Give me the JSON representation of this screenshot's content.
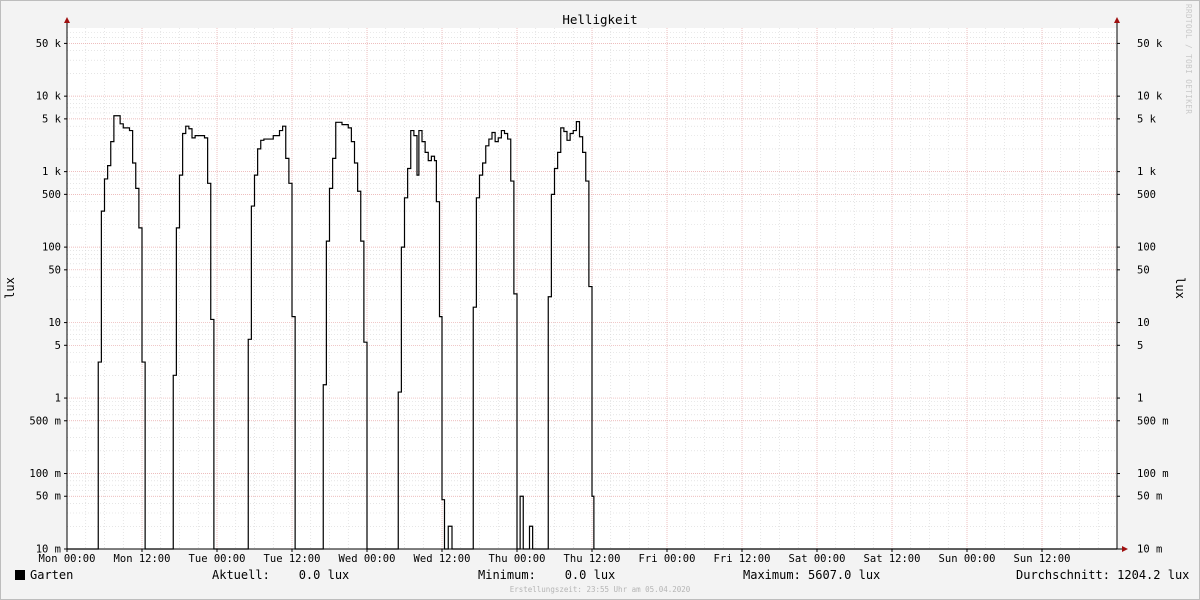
{
  "chart_data": {
    "type": "line",
    "title": "Helligkeit",
    "ylabel": "lux",
    "y_scale": "log",
    "ylim": [
      0.01,
      80000
    ],
    "y_ticks": [
      {
        "v": 0.01,
        "label": "10 m"
      },
      {
        "v": 0.05,
        "label": "50 m"
      },
      {
        "v": 0.1,
        "label": "100 m"
      },
      {
        "v": 0.5,
        "label": "500 m"
      },
      {
        "v": 1,
        "label": "1"
      },
      {
        "v": 5,
        "label": "5"
      },
      {
        "v": 10,
        "label": "10"
      },
      {
        "v": 50,
        "label": "50"
      },
      {
        "v": 100,
        "label": "100"
      },
      {
        "v": 500,
        "label": "500"
      },
      {
        "v": 1000,
        "label": "1 k"
      },
      {
        "v": 5000,
        "label": "5 k"
      },
      {
        "v": 10000,
        "label": "10 k"
      },
      {
        "v": 50000,
        "label": "50 k"
      }
    ],
    "x_unit": "hours since Mon 00:00",
    "xlim": [
      0,
      168
    ],
    "x_ticks": [
      {
        "v": 0,
        "label": "Mon 00:00"
      },
      {
        "v": 12,
        "label": "Mon 12:00"
      },
      {
        "v": 24,
        "label": "Tue 00:00"
      },
      {
        "v": 36,
        "label": "Tue 12:00"
      },
      {
        "v": 48,
        "label": "Wed 00:00"
      },
      {
        "v": 60,
        "label": "Wed 12:00"
      },
      {
        "v": 72,
        "label": "Thu 00:00"
      },
      {
        "v": 84,
        "label": "Thu 12:00"
      },
      {
        "v": 96,
        "label": "Fri 00:00"
      },
      {
        "v": 108,
        "label": "Fri 12:00"
      },
      {
        "v": 120,
        "label": "Sat 00:00"
      },
      {
        "v": 132,
        "label": "Sat 12:00"
      },
      {
        "v": 144,
        "label": "Sun 00:00"
      },
      {
        "v": 156,
        "label": "Sun 12:00"
      }
    ],
    "grid": true,
    "series": [
      {
        "name": "Garten",
        "color": "#000000",
        "points": [
          [
            0,
            0.01
          ],
          [
            5.0,
            0.01
          ],
          [
            5.0,
            3
          ],
          [
            5.5,
            3
          ],
          [
            5.5,
            300
          ],
          [
            6.0,
            300
          ],
          [
            6.0,
            800
          ],
          [
            6.5,
            800
          ],
          [
            6.5,
            1200
          ],
          [
            7.0,
            1200
          ],
          [
            7.0,
            2500
          ],
          [
            7.5,
            2500
          ],
          [
            7.5,
            5500
          ],
          [
            8.5,
            5500
          ],
          [
            8.5,
            4300
          ],
          [
            9.0,
            4300
          ],
          [
            9.0,
            3800
          ],
          [
            10.0,
            3800
          ],
          [
            10.0,
            3500
          ],
          [
            10.5,
            3500
          ],
          [
            10.5,
            1300
          ],
          [
            11.0,
            1300
          ],
          [
            11.0,
            600
          ],
          [
            11.5,
            600
          ],
          [
            11.5,
            180
          ],
          [
            12.0,
            180
          ],
          [
            12.0,
            3
          ],
          [
            12.5,
            3
          ],
          [
            12.5,
            0.01
          ],
          [
            17.0,
            0.01
          ],
          [
            17.0,
            2
          ],
          [
            17.5,
            2
          ],
          [
            17.5,
            180
          ],
          [
            18.0,
            180
          ],
          [
            18.0,
            900
          ],
          [
            18.5,
            900
          ],
          [
            18.5,
            3200
          ],
          [
            19.0,
            3200
          ],
          [
            19.0,
            4000
          ],
          [
            19.5,
            4000
          ],
          [
            19.5,
            3700
          ],
          [
            20.0,
            3700
          ],
          [
            20.0,
            2800
          ],
          [
            20.5,
            2800
          ],
          [
            20.5,
            3000
          ],
          [
            22.0,
            3000
          ],
          [
            22.0,
            2800
          ],
          [
            22.5,
            2800
          ],
          [
            22.5,
            700
          ],
          [
            23.0,
            700
          ],
          [
            23.0,
            11
          ],
          [
            23.5,
            11
          ],
          [
            23.5,
            0.01
          ],
          [
            29.0,
            0.01
          ],
          [
            29.0,
            6
          ],
          [
            29.5,
            6
          ],
          [
            29.5,
            350
          ],
          [
            30.0,
            350
          ],
          [
            30.0,
            900
          ],
          [
            30.5,
            900
          ],
          [
            30.5,
            2000
          ],
          [
            31.0,
            2000
          ],
          [
            31.0,
            2600
          ],
          [
            31.5,
            2600
          ],
          [
            31.5,
            2700
          ],
          [
            33.0,
            2700
          ],
          [
            33.0,
            3000
          ],
          [
            34.0,
            3000
          ],
          [
            34.0,
            3500
          ],
          [
            34.5,
            3500
          ],
          [
            34.5,
            4000
          ],
          [
            35.0,
            4000
          ],
          [
            35.0,
            1500
          ],
          [
            35.5,
            1500
          ],
          [
            35.5,
            700
          ],
          [
            36.0,
            700
          ],
          [
            36.0,
            12
          ],
          [
            36.5,
            12
          ],
          [
            36.5,
            0.01
          ],
          [
            41.0,
            0.01
          ],
          [
            41.0,
            1.5
          ],
          [
            41.5,
            1.5
          ],
          [
            41.5,
            120
          ],
          [
            42.0,
            120
          ],
          [
            42.0,
            600
          ],
          [
            42.5,
            600
          ],
          [
            42.5,
            1500
          ],
          [
            43.0,
            1500
          ],
          [
            43.0,
            4500
          ],
          [
            44.0,
            4500
          ],
          [
            44.0,
            4200
          ],
          [
            45.0,
            4200
          ],
          [
            45.0,
            3800
          ],
          [
            45.5,
            3800
          ],
          [
            45.5,
            2500
          ],
          [
            46.0,
            2500
          ],
          [
            46.0,
            1300
          ],
          [
            46.5,
            1300
          ],
          [
            46.5,
            550
          ],
          [
            47.0,
            550
          ],
          [
            47.0,
            120
          ],
          [
            47.5,
            120
          ],
          [
            47.5,
            5.5
          ],
          [
            48.0,
            5.5
          ],
          [
            48.0,
            0.01
          ],
          [
            53.0,
            0.01
          ],
          [
            53.0,
            1.2
          ],
          [
            53.5,
            1.2
          ],
          [
            53.5,
            100
          ],
          [
            54.0,
            100
          ],
          [
            54.0,
            450
          ],
          [
            54.5,
            450
          ],
          [
            54.5,
            1100
          ],
          [
            55.0,
            1100
          ],
          [
            55.0,
            3500
          ],
          [
            55.5,
            3500
          ],
          [
            55.5,
            3000
          ],
          [
            56.0,
            3000
          ],
          [
            56.0,
            900
          ],
          [
            56.3,
            900
          ],
          [
            56.3,
            3500
          ],
          [
            56.8,
            3500
          ],
          [
            56.8,
            2500
          ],
          [
            57.3,
            2500
          ],
          [
            57.3,
            1800
          ],
          [
            57.8,
            1800
          ],
          [
            57.8,
            1400
          ],
          [
            58.3,
            1400
          ],
          [
            58.3,
            1600
          ],
          [
            58.8,
            1600
          ],
          [
            58.8,
            1400
          ],
          [
            59.1,
            1400
          ],
          [
            59.1,
            400
          ],
          [
            59.6,
            400
          ],
          [
            59.6,
            12
          ],
          [
            60.0,
            12
          ],
          [
            60.0,
            0.045
          ],
          [
            60.4,
            0.045
          ],
          [
            60.4,
            0.01
          ],
          [
            61.0,
            0.01
          ],
          [
            61.0,
            0.02
          ],
          [
            61.6,
            0.02
          ],
          [
            61.6,
            0.01
          ],
          [
            65.0,
            0.01
          ],
          [
            65.0,
            16
          ],
          [
            65.5,
            16
          ],
          [
            65.5,
            450
          ],
          [
            66.0,
            450
          ],
          [
            66.0,
            900
          ],
          [
            66.5,
            900
          ],
          [
            66.5,
            1300
          ],
          [
            67.0,
            1300
          ],
          [
            67.0,
            2200
          ],
          [
            67.5,
            2200
          ],
          [
            67.5,
            2700
          ],
          [
            68.0,
            2700
          ],
          [
            68.0,
            3300
          ],
          [
            68.5,
            3300
          ],
          [
            68.5,
            2500
          ],
          [
            69.0,
            2500
          ],
          [
            69.0,
            2800
          ],
          [
            69.5,
            2800
          ],
          [
            69.5,
            3500
          ],
          [
            70.0,
            3500
          ],
          [
            70.0,
            3200
          ],
          [
            70.5,
            3200
          ],
          [
            70.5,
            2700
          ],
          [
            71.0,
            2700
          ],
          [
            71.0,
            750
          ],
          [
            71.5,
            750
          ],
          [
            71.5,
            24
          ],
          [
            72.0,
            24
          ],
          [
            72.0,
            0.01
          ],
          [
            72.5,
            0.01
          ],
          [
            72.5,
            0.05
          ],
          [
            73.0,
            0.05
          ],
          [
            73.0,
            0.01
          ],
          [
            74.0,
            0.01
          ],
          [
            74.0,
            0.02
          ],
          [
            74.5,
            0.02
          ],
          [
            74.5,
            0.01
          ],
          [
            77.0,
            0.01
          ],
          [
            77.0,
            22
          ],
          [
            77.5,
            22
          ],
          [
            77.5,
            500
          ],
          [
            78.0,
            500
          ],
          [
            78.0,
            1100
          ],
          [
            78.5,
            1100
          ],
          [
            78.5,
            1800
          ],
          [
            79.0,
            1800
          ],
          [
            79.0,
            3800
          ],
          [
            79.5,
            3800
          ],
          [
            79.5,
            3400
          ],
          [
            80.0,
            3400
          ],
          [
            80.0,
            2600
          ],
          [
            80.5,
            2600
          ],
          [
            80.5,
            3200
          ],
          [
            81.0,
            3200
          ],
          [
            81.0,
            3500
          ],
          [
            81.5,
            3500
          ],
          [
            81.5,
            4600
          ],
          [
            82.0,
            4600
          ],
          [
            82.0,
            2900
          ],
          [
            82.5,
            2900
          ],
          [
            82.5,
            1800
          ],
          [
            83.0,
            1800
          ],
          [
            83.0,
            750
          ],
          [
            83.5,
            750
          ],
          [
            83.5,
            30
          ],
          [
            84.0,
            30
          ],
          [
            84.0,
            0.05
          ],
          [
            84.3,
            0.05
          ],
          [
            84.3,
            0.01
          ],
          [
            168,
            0.01
          ]
        ]
      }
    ]
  },
  "legend": {
    "series_label": "Garten",
    "aktuell": "Aktuell:    0.0 lux",
    "minimum": "Minimum:    0.0 lux",
    "maximum": "Maximum: 5607.0 lux",
    "durchschnitt": "Durchschnitt: 1204.2 lux"
  },
  "credit": "RRDTOOL / TOBI OETIKER",
  "footer": "Erstellungszeit: 23:55 Uhr am 05.04.2020",
  "colors": {
    "grid_major": "#e8a8a8",
    "grid_minor": "#d6d6d6",
    "axis": "#000000",
    "arrow": "#a01010",
    "plot_bg": "#ffffff",
    "page_bg": "#f3f3f3"
  }
}
